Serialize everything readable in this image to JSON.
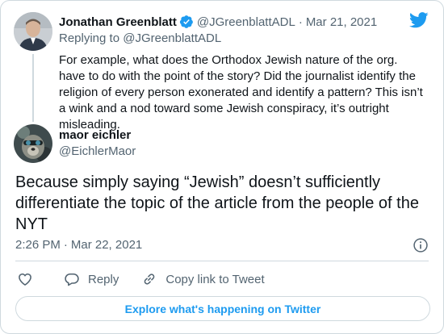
{
  "colors": {
    "accent": "#1d9bf0",
    "muted": "#536471",
    "text": "#0f1419",
    "border": "#cfd9de"
  },
  "parent_tweet": {
    "display_name": "Jonathan Greenblatt",
    "handle": "@JGreenblattADL",
    "separator": "·",
    "date": "Mar 21, 2021",
    "verified_icon": "verified-badge-icon",
    "replying_to": "Replying to @JGreenblattADL",
    "text": "For example, what does the Orthodox Jewish nature of the org. have to do with the point of the story? Did the journalist identify the religion of every person exonerated and identify a pattern? This isn’t a wink and a nod toward some Jewish conspiracy, it’s outright misleading."
  },
  "main_tweet": {
    "display_name": "maor eichler",
    "handle": "@EichlerMaor",
    "text": "Because simply saying “Jewish” doesn’t sufficiently differentiate the topic of the article from the people of the NYT",
    "time": "2:26 PM",
    "separator": "·",
    "date": "Mar 22, 2021"
  },
  "actions": {
    "like_icon": "heart-icon",
    "reply_label": "Reply",
    "copy_link_label": "Copy link to Tweet"
  },
  "footer": {
    "explore_label": "Explore what's happening on Twitter"
  }
}
